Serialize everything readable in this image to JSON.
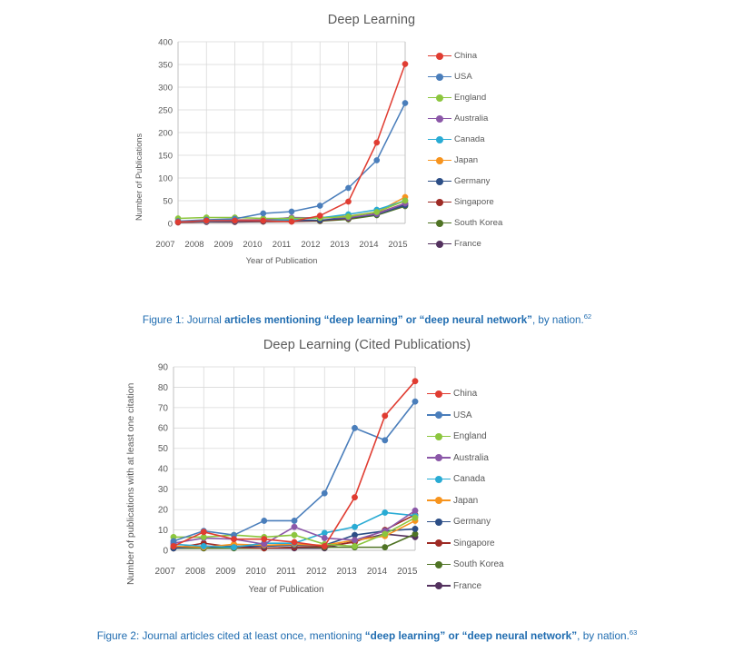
{
  "page": {
    "background": "#ffffff",
    "caption_color": "#1f6cb0",
    "text_color": "#595959"
  },
  "series_palette": [
    {
      "name": "China",
      "color": "#E03C31"
    },
    {
      "name": "USA",
      "color": "#4A7EBB"
    },
    {
      "name": "England",
      "color": "#8CC63E"
    },
    {
      "name": "Australia",
      "color": "#8B57A8"
    },
    {
      "name": "Canada",
      "color": "#29ABD4"
    },
    {
      "name": "Japan",
      "color": "#F7941E"
    },
    {
      "name": "Germany",
      "color": "#2C4E86"
    },
    {
      "name": "Singapore",
      "color": "#9E2B25"
    },
    {
      "name": "South Korea",
      "color": "#4F7324"
    },
    {
      "name": "France",
      "color": "#53315E"
    }
  ],
  "figure1": {
    "title": "Deep Learning",
    "caption": {
      "prefix": "Figure 1: Journal ",
      "bold": "articles mentioning “deep learning” or “deep neural network”",
      "suffix": ", by nation.",
      "footnote": "62"
    },
    "legend_position": "right"
  },
  "figure2": {
    "title": "Deep Learning (Cited Publications)",
    "caption": {
      "prefix": "Figure 2: Journal articles cited at least once, mentioning ",
      "bold": "“deep learning” or “deep neural network”",
      "suffix": ", by nation.",
      "footnote": "63"
    },
    "legend_position": "right"
  },
  "chart_data": [
    {
      "id": "chart1",
      "type": "line",
      "title": "Deep Learning",
      "xlabel": "Year of Publication",
      "ylabel": "Number of Publications",
      "categories": [
        "2007",
        "2008",
        "2009",
        "2010",
        "2011",
        "2012",
        "2013",
        "2014",
        "2015"
      ],
      "ylim": [
        0,
        400
      ],
      "yticks": [
        0,
        50,
        100,
        150,
        200,
        250,
        300,
        350,
        400
      ],
      "grid": true,
      "legend": [
        "China",
        "USA",
        "England",
        "Australia",
        "Canada",
        "Japan",
        "Germany",
        "Singapore",
        "South Korea",
        "France"
      ],
      "series": [
        {
          "name": "China",
          "color": "#E03C31",
          "values": [
            3,
            6,
            6,
            6,
            4,
            17,
            48,
            178,
            351
          ]
        },
        {
          "name": "USA",
          "color": "#4A7EBB",
          "values": [
            5,
            8,
            10,
            22,
            26,
            39,
            78,
            139,
            265
          ]
        },
        {
          "name": "England",
          "color": "#8CC63E",
          "values": [
            11,
            13,
            13,
            11,
            11,
            12,
            15,
            25,
            50
          ]
        },
        {
          "name": "Australia",
          "color": "#8B57A8",
          "values": [
            4,
            6,
            7,
            8,
            13,
            12,
            13,
            21,
            44
          ]
        },
        {
          "name": "Canada",
          "color": "#29ABD4",
          "values": [
            4,
            5,
            6,
            7,
            8,
            12,
            20,
            30,
            50
          ]
        },
        {
          "name": "Japan",
          "color": "#F7941E",
          "values": [
            4,
            6,
            8,
            8,
            9,
            13,
            16,
            25,
            58
          ]
        },
        {
          "name": "Germany",
          "color": "#2C4E86",
          "values": [
            3,
            4,
            4,
            5,
            6,
            7,
            12,
            20,
            40
          ]
        },
        {
          "name": "Singapore",
          "color": "#9E2B25",
          "values": [
            2,
            3,
            3,
            4,
            4,
            6,
            11,
            22,
            44
          ]
        },
        {
          "name": "South Korea",
          "color": "#4F7324",
          "values": [
            3,
            4,
            4,
            4,
            5,
            5,
            9,
            18,
            38
          ]
        },
        {
          "name": "France",
          "color": "#53315E",
          "values": [
            3,
            4,
            4,
            5,
            5,
            6,
            10,
            20,
            42
          ]
        }
      ]
    },
    {
      "id": "chart2",
      "type": "line",
      "title": "Deep Learning (Cited Publications)",
      "xlabel": "Year of Publication",
      "ylabel": "Number of publications with at least one citation",
      "categories": [
        "2007",
        "2008",
        "2009",
        "2010",
        "2011",
        "2012",
        "2013",
        "2014",
        "2015"
      ],
      "ylim": [
        0,
        90
      ],
      "yticks": [
        0,
        10,
        20,
        30,
        40,
        50,
        60,
        70,
        80,
        90
      ],
      "grid": true,
      "legend": [
        "China",
        "USA",
        "England",
        "Australia",
        "Canada",
        "Japan",
        "Germany",
        "Singapore",
        "South Korea",
        "France"
      ],
      "series": [
        {
          "name": "China",
          "color": "#E03C31",
          "values": [
            2,
            9,
            5.5,
            5.5,
            4,
            2,
            26,
            66,
            83
          ]
        },
        {
          "name": "USA",
          "color": "#4A7EBB",
          "values": [
            4.5,
            9.5,
            7.5,
            14.5,
            14.5,
            28,
            60,
            54,
            73
          ]
        },
        {
          "name": "England",
          "color": "#8CC63E",
          "values": [
            6.5,
            6.5,
            7.5,
            6.5,
            7.5,
            3,
            2,
            8,
            16
          ]
        },
        {
          "name": "Australia",
          "color": "#8B57A8",
          "values": [
            3.5,
            6,
            5.5,
            3,
            11.5,
            6,
            5,
            9.5,
            19.5
          ]
        },
        {
          "name": "Canada",
          "color": "#29ABD4",
          "values": [
            3,
            2,
            1.5,
            3.5,
            3.5,
            8.5,
            11.5,
            18.5,
            17
          ]
        },
        {
          "name": "Japan",
          "color": "#F7941E",
          "values": [
            2,
            1.5,
            3,
            2.5,
            3,
            2.5,
            5,
            7,
            14.5
          ]
        },
        {
          "name": "Germany",
          "color": "#2C4E86",
          "values": [
            1,
            2,
            2,
            2,
            2.5,
            2.5,
            7.5,
            9.5,
            10.5
          ]
        },
        {
          "name": "Singapore",
          "color": "#9E2B25",
          "values": [
            1,
            3.5,
            1.5,
            1,
            1.5,
            2,
            4,
            10,
            17.5
          ]
        },
        {
          "name": "South Korea",
          "color": "#4F7324",
          "values": [
            1,
            1,
            1,
            1,
            1.5,
            1.5,
            1.5,
            1.5,
            8
          ]
        },
        {
          "name": "France",
          "color": "#53315E",
          "values": [
            1,
            1,
            2,
            1,
            1,
            1,
            4.5,
            8,
            6.5
          ]
        }
      ]
    }
  ]
}
